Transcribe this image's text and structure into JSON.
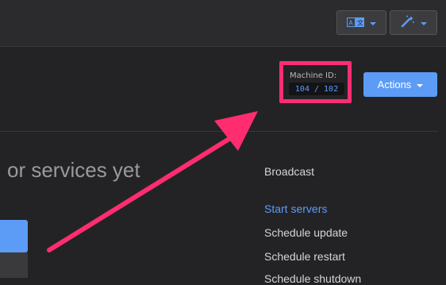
{
  "toolbar": {
    "translate_icon": "translate-icon",
    "magic_icon": "magic-wand-icon"
  },
  "machine": {
    "label": "Machine ID:",
    "value": "104 / 102"
  },
  "actions": {
    "label": "Actions"
  },
  "empty_state": {
    "heading": "or services yet"
  },
  "menu": {
    "items": [
      {
        "label": "Broadcast"
      },
      {
        "label": "Start servers"
      },
      {
        "label": "Schedule update"
      },
      {
        "label": "Schedule restart"
      },
      {
        "label": "Schedule shutdown"
      }
    ]
  },
  "colors": {
    "accent": "#5c9cf6",
    "highlight": "#ff2d70",
    "background": "#232325"
  }
}
